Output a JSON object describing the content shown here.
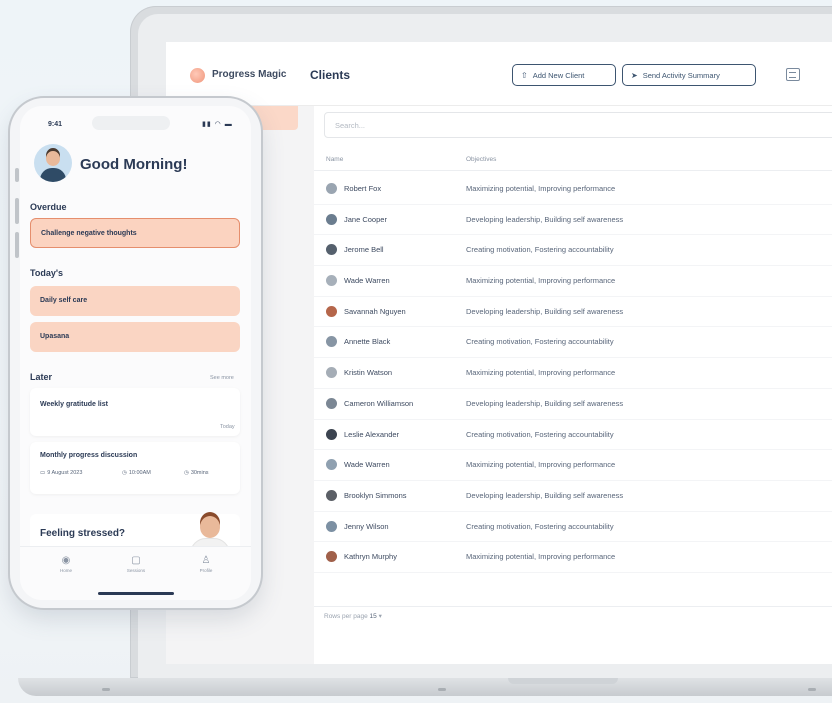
{
  "app": {
    "brand": "Progress Magic",
    "page_title": "Clients",
    "add_client_label": "Add New Client",
    "send_summary_label": "Send Activity Summary",
    "search_placeholder": "Search...",
    "columns": {
      "name": "Name",
      "objectives": "Objectives"
    },
    "clients": [
      {
        "name": "Robert Fox",
        "objectives": "Maximizing potential, Improving performance",
        "avatar_color": "#9aa5b1"
      },
      {
        "name": "Jane Cooper",
        "objectives": "Developing leadership, Building self awareness",
        "avatar_color": "#6b7d8f"
      },
      {
        "name": "Jerome Bell",
        "objectives": "Creating motivation, Fostering accountability",
        "avatar_color": "#55606d"
      },
      {
        "name": "Wade Warren",
        "objectives": "Maximizing potential, Improving performance",
        "avatar_color": "#a7b0ba"
      },
      {
        "name": "Savannah Nguyen",
        "objectives": "Developing leadership, Building self awareness",
        "avatar_color": "#b5664a"
      },
      {
        "name": "Annette Black",
        "objectives": "Creating motivation, Fostering accountability",
        "avatar_color": "#8795a4"
      },
      {
        "name": "Kristin Watson",
        "objectives": "Maximizing potential, Improving performance",
        "avatar_color": "#a5adb6"
      },
      {
        "name": "Cameron Williamson",
        "objectives": "Developing leadership, Building self awareness",
        "avatar_color": "#7b8794"
      },
      {
        "name": "Leslie Alexander",
        "objectives": "Creating motivation, Fostering accountability",
        "avatar_color": "#3c4450"
      },
      {
        "name": "Wade Warren",
        "objectives": "Maximizing potential, Improving performance",
        "avatar_color": "#8fa0b0"
      },
      {
        "name": "Brooklyn Simmons",
        "objectives": "Developing leadership, Building self awareness",
        "avatar_color": "#5b5f66"
      },
      {
        "name": "Jenny Wilson",
        "objectives": "Creating motivation, Fostering accountability",
        "avatar_color": "#7c90a3"
      },
      {
        "name": "Kathryn Murphy",
        "objectives": "Maximizing potential, Improving performance",
        "avatar_color": "#a0604a"
      }
    ],
    "pager_label": "Rows per page",
    "pager_value": "15"
  },
  "phone": {
    "time": "9:41",
    "greeting": "Good Morning!",
    "overdue_title": "Overdue",
    "overdue_task": "Challenge negative thoughts",
    "today_title": "Today's",
    "today_tasks": [
      "Daily self care",
      "Upasana"
    ],
    "later_title": "Later",
    "later_link": "See more",
    "weekly_title": "Weekly gratitude list",
    "weekly_meta": "Today",
    "monthly_title": "Monthly progress discussion",
    "monthly_date": "9 August 2023",
    "monthly_time": "10:00AM",
    "monthly_duration": "30mins",
    "stress_title": "Feeling stressed?",
    "tabs": [
      "Home",
      "Sessions",
      "Profile"
    ]
  },
  "colors": {
    "accent_peach": "#fad5c3",
    "overdue_border": "#e58e6d",
    "text_navy": "#2b3a55"
  }
}
